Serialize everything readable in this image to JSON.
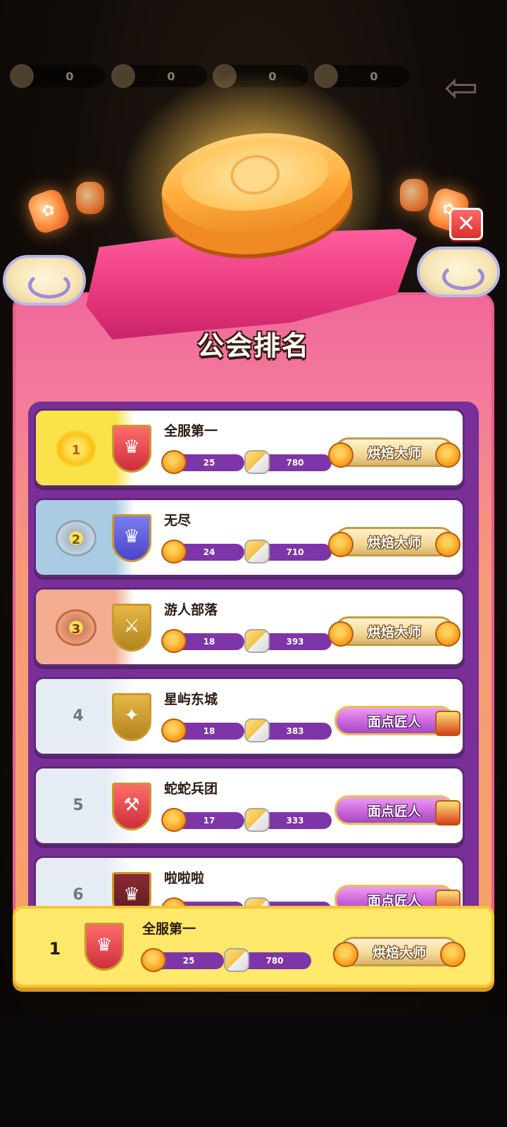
{
  "topbar": {
    "resources": [
      {
        "icon": "bread-icon",
        "value": "0"
      },
      {
        "icon": "bottle-icon",
        "value": "0"
      },
      {
        "icon": "flour-bowl-icon",
        "value": "0"
      },
      {
        "icon": "dish-icon",
        "value": "0"
      }
    ]
  },
  "panel": {
    "title": "公会排名",
    "close_label": "✕"
  },
  "rows": [
    {
      "rank": "1",
      "rank_style": "gold",
      "emblem": "red",
      "name": "全服第一",
      "mooncakes": "25",
      "ingredients": "780",
      "title": "烘焙大师",
      "title_style": "master"
    },
    {
      "rank": "2",
      "rank_style": "silver",
      "emblem": "blue",
      "name": "无尽",
      "mooncakes": "24",
      "ingredients": "710",
      "title": "烘焙大师",
      "title_style": "master"
    },
    {
      "rank": "3",
      "rank_style": "bronze",
      "emblem": "gold",
      "name": "游人部落",
      "mooncakes": "18",
      "ingredients": "393",
      "title": "烘焙大师",
      "title_style": "master"
    },
    {
      "rank": "4",
      "rank_style": "plain",
      "emblem": "gold",
      "name": "星屿东城",
      "mooncakes": "18",
      "ingredients": "383",
      "title": "面点匠人",
      "title_style": "artisan"
    },
    {
      "rank": "5",
      "rank_style": "plain",
      "emblem": "red",
      "name": "蛇蛇兵团",
      "mooncakes": "17",
      "ingredients": "333",
      "title": "面点匠人",
      "title_style": "artisan"
    },
    {
      "rank": "6",
      "rank_style": "plain",
      "emblem": "maroon",
      "name": "啦啦啦",
      "mooncakes": "",
      "ingredients": "",
      "title": "面点匠人",
      "title_style": "artisan"
    }
  ],
  "own_guild": {
    "rank": "1",
    "name": "全服第一",
    "mooncakes": "25",
    "ingredients": "780",
    "title": "烘焙大师"
  },
  "colors": {
    "panel_pink": "#f0689a",
    "panel_orange": "#f7a06a",
    "list_purple": "#7a2f98",
    "own_row_yellow": "#ffe86a",
    "stat_bar_purple": "#7d35a8"
  }
}
